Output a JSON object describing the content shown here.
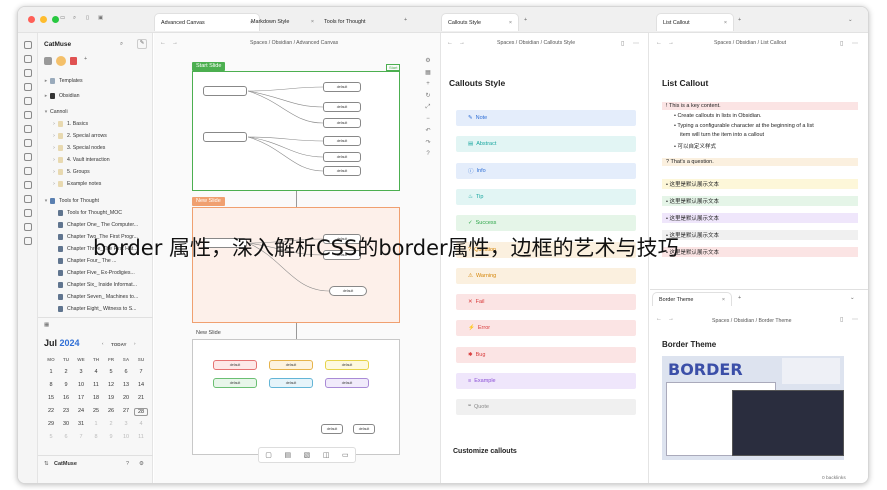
{
  "window": {
    "traffic_colors": [
      "#ff5f57",
      "#febc2e",
      "#28c840"
    ]
  },
  "tabs": {
    "canvas": "Advanced Canvas",
    "markdown": "Markdown Style",
    "thought": "Tools for Thought",
    "callouts": "Callouts Style",
    "list": "List Callout",
    "border": "Border Theme"
  },
  "sidebar": {
    "vault": "CatMuse",
    "templates": "Templates",
    "obsidian": "Obsidian",
    "cannoli": "Cannoli",
    "cannoli_items": [
      "1. Basics",
      "2. Special arrows",
      "3. Special nodes",
      "4. Vault interaction",
      "5. Groups",
      "Example notes"
    ],
    "tools_folder": "Tools for Thought",
    "tools_items": [
      "Tools for Thought_MOC",
      "Chapter One_ The Computer...",
      "Chapter Two_The First Progr...",
      "Chapter Three_The First Hat...",
      "Chapter Four_ The ...",
      "Chapter Five_ Ex-Prodigies...",
      "Chapter Six_ Inside Informat...",
      "Chapter Seven_ Machines to...",
      "Chapter Eight_ Witness to S..."
    ],
    "footer_vault": "CatMuse"
  },
  "calendar": {
    "month": "Jul",
    "year": "2024",
    "today": "TODAY",
    "weekdays": [
      "MO",
      "TU",
      "WE",
      "TH",
      "FR",
      "SA",
      "SU"
    ],
    "weeks": [
      [
        "1",
        "2",
        "3",
        "4",
        "5",
        "6",
        "7"
      ],
      [
        "8",
        "9",
        "10",
        "11",
        "12",
        "13",
        "14"
      ],
      [
        "15",
        "16",
        "17",
        "18",
        "19",
        "20",
        "21"
      ],
      [
        "22",
        "23",
        "24",
        "25",
        "26",
        "27",
        "28"
      ],
      [
        "29",
        "30",
        "31",
        "1",
        "2",
        "3",
        "4"
      ],
      [
        "5",
        "6",
        "7",
        "8",
        "9",
        "10",
        "11"
      ]
    ]
  },
  "canvas": {
    "breadcrumb": [
      "Spaces",
      "Obsidian",
      "Advanced Canvas"
    ],
    "slide1": "Start Slide",
    "slide1_tag": "Start",
    "slide2": "New Slide",
    "slide3": "New Slide"
  },
  "callouts": {
    "breadcrumb": [
      "Spaces",
      "Obsidian",
      "Callouts Style"
    ],
    "title": "Callouts Style",
    "items": [
      {
        "label": "Note",
        "color": "#2f6fd6",
        "bg": "#e4edfb"
      },
      {
        "label": "Abstract",
        "color": "#1aa7a0",
        "bg": "#e2f5f4"
      },
      {
        "label": "Info",
        "color": "#2f6fd6",
        "bg": "#e4edfb"
      },
      {
        "label": "Tip",
        "color": "#1aa7a0",
        "bg": "#e2f5f4"
      },
      {
        "label": "Success",
        "color": "#2ea64a",
        "bg": "#e5f5e8"
      },
      {
        "label": "Question",
        "color": "#d5860a",
        "bg": "#fbf0df"
      },
      {
        "label": "Warning",
        "color": "#d5860a",
        "bg": "#fbf0df"
      },
      {
        "label": "Fail",
        "color": "#d83a3a",
        "bg": "#fbe4e4"
      },
      {
        "label": "Error",
        "color": "#d83a3a",
        "bg": "#fbe4e4"
      },
      {
        "label": "Bug",
        "color": "#d83a3a",
        "bg": "#fbe4e4"
      },
      {
        "label": "Example",
        "color": "#8a4fd6",
        "bg": "#efe6fb"
      },
      {
        "label": "Quote",
        "color": "#888888",
        "bg": "#f0f0f0"
      }
    ],
    "customize": "Customize callouts"
  },
  "list_callout": {
    "breadcrumb": [
      "Spaces",
      "Obsidian",
      "List Callout"
    ],
    "title": "List Callout",
    "lines": [
      {
        "text": "! This is a key content.",
        "bg": "#fbe4e4"
      },
      {
        "text": "• Create callouts in lists in Obsidian.",
        "bg": ""
      },
      {
        "text": "• Typing a configurable character at the beginning of a list",
        "bg": ""
      },
      {
        "text": "item will turn the item into a callout",
        "bg": ""
      },
      {
        "text": "• 可以自定义样式",
        "bg": ""
      },
      {
        "text": "? That's a question.",
        "bg": "#fbf0df"
      },
      {
        "text": "• 这里是默认展示文本",
        "bg": "#fdf7d9"
      },
      {
        "text": "• 这里是默认展示文本",
        "bg": "#e5f5e8"
      },
      {
        "text": "• 这里是默认展示文本",
        "bg": "#efe6fb"
      },
      {
        "text": "• 这里是默认展示文本",
        "bg": "#f0f0f0"
      },
      {
        "text": "• 这里是默认展示文本",
        "bg": "#fbe4e4"
      }
    ]
  },
  "border_pane": {
    "breadcrumb": [
      "Spaces",
      "Obsidian",
      "Border Theme"
    ],
    "title": "Border Theme",
    "banner": "BORDER"
  },
  "status": {
    "backlinks": "0 backlinks"
  },
  "overlay_caption": "border 属性，深入解析CSS的border属性，边框的艺术与技巧"
}
